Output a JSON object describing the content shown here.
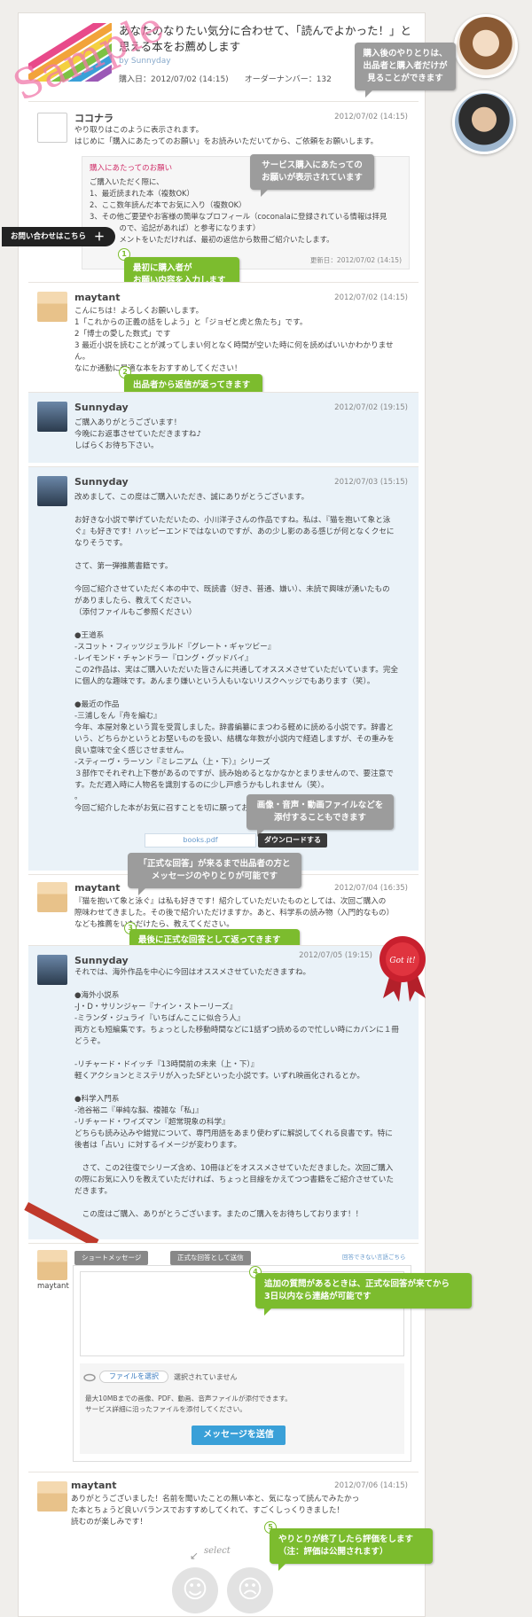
{
  "header": {
    "title": "あなたのなりたい気分に合わせて、「読んでよかった！」と思える本をお薦めします",
    "by": "by Sunnyday",
    "purchase": "購入日：2012/07/02 (14:15)　　オーダーナンバー：132",
    "sample": "Sample"
  },
  "callouts": {
    "top_right": "購入後のやりとりは、\n出品者と購入者だけが\n見ることができます",
    "service": "サービス購入にあたっての\nお願いが表示されています",
    "c1": "最初に購入者が\nお願い内容を入力します",
    "c2": "出品者から返信が返ってきます",
    "attach": "画像・音声・動画ファイルなどを\n添付することもできます",
    "official": "「正式な回答」が来るまで出品者の方と\nメッセージのやりとりが可能です",
    "c3": "最後に正式な回答として返ってきます",
    "c4": "追加の質問があるときは、正式な回答が来てから\n3日以内なら連絡が可能です",
    "c5": "やりとりが終了したら評価をします\n（注：評価は公開されます）",
    "n1": "1",
    "n2": "2",
    "n3": "3",
    "n4": "4",
    "n5": "5"
  },
  "contact": {
    "label": "お問い合わせはこちら",
    "plus": "＋"
  },
  "msg1": {
    "name": "ココナラ",
    "date": "2012/07/02 (14:15)",
    "text": "やり取りはこのように表示されます。\nはじめに「購入にあたってのお願い」をお読みいただいてから、ご依頼をお願いします。",
    "notice_head": "購入にあたってのお願い",
    "notice_body": "ご購入いただく際に、\n1、最近読まれた本（複数OK）\n2、ここ数年読んだ本でお気に入り（複数OK）\n3、その他ご要望やお客様の簡単なプロフィール（coconalaに登録されている情報は拝見\n　　　　ので、追記があれば）と参考になります）\n　　　　メントをいただければ、最初の返信から数冊ご紹介いたします。",
    "updated": "更新日：2012/07/02 (14:15)"
  },
  "msg2": {
    "name": "maytant",
    "date": "2012/07/02 (14:15)",
    "text": "こんにちは！よろしくお願いします。\n1「これからの正義の話をしよう」と「ジョゼと虎と魚たち」です。\n2「博士の愛した数式」です\n3 最近小説を読むことが減ってしまい何となく時間が空いた時に何を読めばいいかわかりませ\nん。\nなにか通勤に最適な本をおすすめしてください！"
  },
  "msg3": {
    "name": "Sunnyday",
    "date": "2012/07/02 (19:15)",
    "text": "ご購入ありがとうございます！\n今晩にお返事させていただきますね♪\nしばらくお待ち下さい。"
  },
  "msg4": {
    "name": "Sunnyday",
    "date": "2012/07/03 (15:15)",
    "text": "改めまして、この度はご購入いただき、誠にありがとうございます。\n\nお好きな小説で挙げていただいたの、小川洋子さんの作品ですね。私は、『猫を抱いて象と泳\nぐ』も好きです！ハッピーエンドではないのですが、あの少し影のある感じが何となくクセに\nなりそうです。\n\nさて、第一弾推薦書籍です。\n\n今回ご紹介させていただく本の中で、既読書（好き、普通、嫌い）、未読で興味が湧いたもの\nがありましたら、教えてください。\n（添付ファイルもご参照ください）\n\n●王道系\n-スコット・フィッツジェラルド『グレート・ギャツビー』\n-レイモンド・チャンドラー『ロング・グッドバイ』\nこの2作品は、実はご購入いただいた皆さんに共通してオススメさせていただいています。完全\nに個人的な趣味です。あんまり嫌いという人もいないリスクヘッジでもあります（笑）。\n\n●最近の作品\n-三浦しをん『舟を編む』\n今年、本屋対象という賞を受賞しました。辞書編纂にまつわる軽めに読める小説です。辞書と\nいう、どちらかというとお堅いものを扱い、結構な年数が小説内で経過しますが、その重みを\n良い意味で全く感じさせません。\n-スティーヴ・ラーソン『ミレニアム（上・下）』シリーズ\n３部作でそれぞれ上下巻があるのですが、読み始めるとなかなかとまりませんので、要注意で\nす。ただ週入時に人物名を識別するのに少し戸惑うかもしれません（笑）。\n。\n今回ご紹介した本がお気に召すことを切に願っております！",
    "file": "books.pdf",
    "download": "ダウンロードする"
  },
  "msg5": {
    "name": "maytant",
    "date": "2012/07/04 (16:35)",
    "text": "『猫を抱いて象と泳ぐ』は私も好きです！紹介していただいたものとしては、次回ご購入の\n際味わせてきました。その後で紹介いただけますか。あと、科学系の読み物（入門的なもの）\nなども推薦をいただけたら、教えてください。"
  },
  "msg6": {
    "name": "Sunnyday",
    "date": "2012/07/05 (19:15)",
    "seal": "Got it!",
    "text": "それでは、海外作品を中心に今回はオススメさせていただきますね。\n\n●海外小説系\n-J・D・サリンジャー『ナイン・ストーリーズ』\n-ミランダ・ジュライ『いちばんここに似合う人』\n両方とも短編集です。ちょっとした移動時間などに1話ずつ読めるので忙しい時にカバンに１冊\nどうぞ。\n\n-リチャード・ドイッチ『13時間前の未来（上・下）』\n軽くアクションとミステリが入ったSFといった小説です。いずれ映画化されるとか。\n\n●科学入門系\n-池谷裕二『単純な脳、複雑な「私」』\n-リチャード・ワイズマン『超常現象の科学』\nどちらも読み込みや錯覚について、専門用語をあまり使わずに解説してくれる良書です。特に\n後者は「占い」に対するイメージが変わります。\n\n　さて、この2往復でシリーズ含め、10冊ほどをオススメさせていただきました。次回ご購入\nの際にお気に入りを教えていただければ、ちょっと目線をかえてつつ書籍をご紹介させていた\nだきます。\n\n　この度はご購入、ありがとうございます。またのご購入をお待ちしております！！"
  },
  "compose": {
    "user": "maytant",
    "tab_short": "ショートメッセージ",
    "tab_official": "正式な回答として送信",
    "link": "回答できない言語ごちら",
    "choose_file": "ファイルを選択",
    "no_file": "選択されていません",
    "note": "最大10MBまでの画像、PDF、動画、音声ファイルが添付できます。\nサービス詳細に沿ったファイルを添付してください。",
    "send": "メッセージを送信"
  },
  "msg7": {
    "name": "maytant",
    "date": "2012/07/06 (14:15)",
    "text": "ありがとうございました！名前を聞いたことの無い本と、気になって読んでみたかっ\nた本とちょうど良いバランスでおすすめしてくれて、すごくしっくりきました！\n読むのが楽しみです！"
  },
  "rating": {
    "select": "select",
    "good": "☺",
    "bad": "☹"
  }
}
